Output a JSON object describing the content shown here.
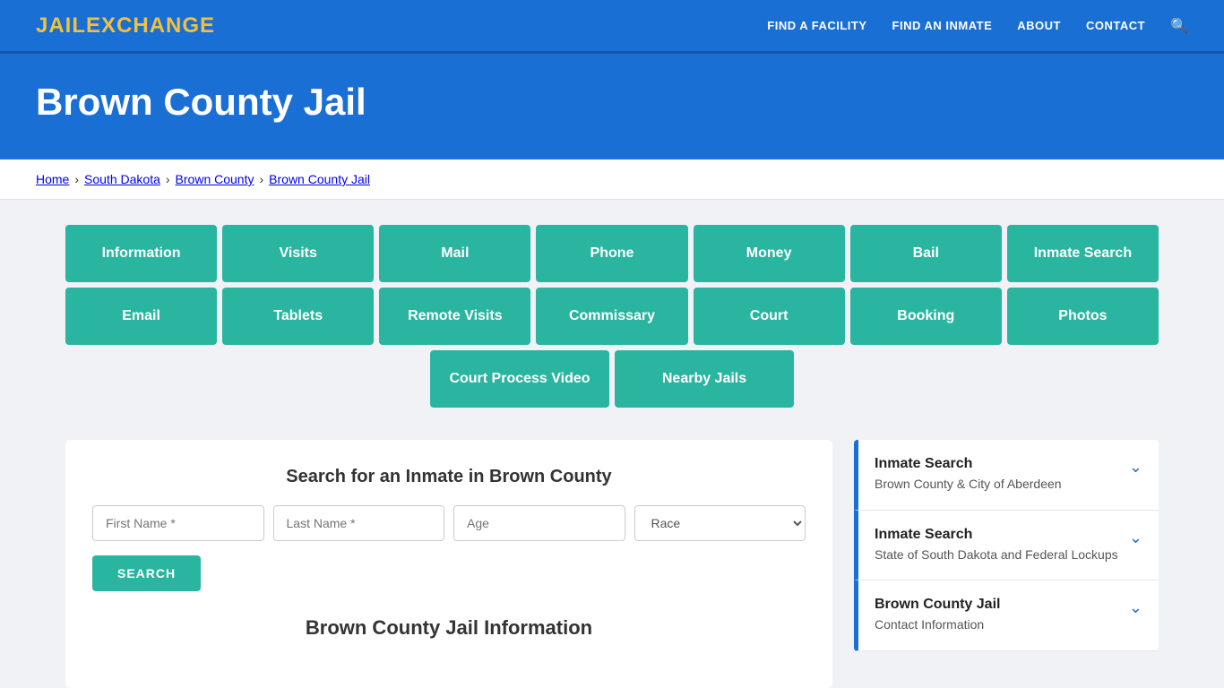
{
  "header": {
    "logo_jail": "JAIL",
    "logo_exchange": "EXCHANGE",
    "nav": [
      {
        "label": "FIND A FACILITY",
        "href": "#"
      },
      {
        "label": "FIND AN INMATE",
        "href": "#"
      },
      {
        "label": "ABOUT",
        "href": "#"
      },
      {
        "label": "CONTACT",
        "href": "#"
      }
    ]
  },
  "hero": {
    "title": "Brown County Jail"
  },
  "breadcrumb": {
    "items": [
      {
        "label": "Home",
        "href": "#"
      },
      {
        "label": "South Dakota",
        "href": "#"
      },
      {
        "label": "Brown County",
        "href": "#"
      },
      {
        "label": "Brown County Jail",
        "href": "#"
      }
    ]
  },
  "grid_buttons_row1": [
    {
      "label": "Information"
    },
    {
      "label": "Visits"
    },
    {
      "label": "Mail"
    },
    {
      "label": "Phone"
    },
    {
      "label": "Money"
    },
    {
      "label": "Bail"
    },
    {
      "label": "Inmate Search"
    }
  ],
  "grid_buttons_row2": [
    {
      "label": "Email"
    },
    {
      "label": "Tablets"
    },
    {
      "label": "Remote Visits"
    },
    {
      "label": "Commissary"
    },
    {
      "label": "Court"
    },
    {
      "label": "Booking"
    },
    {
      "label": "Photos"
    }
  ],
  "grid_buttons_row3": [
    {
      "label": "Court Process Video"
    },
    {
      "label": "Nearby Jails"
    }
  ],
  "search_form": {
    "heading": "Search for an Inmate in Brown County",
    "first_name_placeholder": "First Name *",
    "last_name_placeholder": "Last Name *",
    "age_placeholder": "Age",
    "race_placeholder": "Race",
    "search_button_label": "SEARCH"
  },
  "bottom_heading": "Brown County Jail Information",
  "sidebar_cards": [
    {
      "title": "Inmate Search",
      "subtitle": "Brown County & City of Aberdeen"
    },
    {
      "title": "Inmate Search",
      "subtitle": "State of South Dakota and Federal Lockups"
    },
    {
      "title": "Brown County Jail",
      "subtitle": "Contact Information"
    }
  ]
}
